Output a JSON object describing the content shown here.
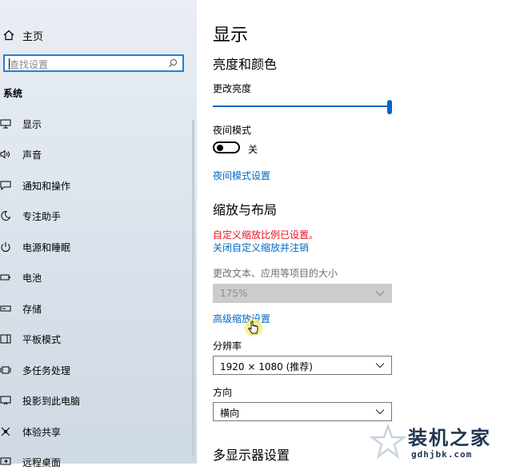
{
  "sidebar": {
    "home_label": "主页",
    "search_placeholder": "查找设置",
    "group_title": "系统",
    "items": [
      {
        "label": "显示",
        "icon": "monitor-icon"
      },
      {
        "label": "声音",
        "icon": "speaker-icon"
      },
      {
        "label": "通知和操作",
        "icon": "notification-icon"
      },
      {
        "label": "专注助手",
        "icon": "moon-icon"
      },
      {
        "label": "电源和睡眠",
        "icon": "power-icon"
      },
      {
        "label": "电池",
        "icon": "battery-icon"
      },
      {
        "label": "存储",
        "icon": "storage-icon"
      },
      {
        "label": "平板模式",
        "icon": "tablet-icon"
      },
      {
        "label": "多任务处理",
        "icon": "multitask-icon"
      },
      {
        "label": "投影到此电脑",
        "icon": "project-icon"
      },
      {
        "label": "体验共享",
        "icon": "share-icon"
      },
      {
        "label": "远程桌面",
        "icon": "remote-desktop-icon"
      }
    ]
  },
  "main": {
    "title": "显示",
    "brightness_section": "亮度和颜色",
    "brightness_label": "更改亮度",
    "brightness_value": 1.0,
    "night_light_label": "夜间模式",
    "night_light_state": "关",
    "night_light_link": "夜间模式设置",
    "scale_section": "缩放与布局",
    "custom_scale_warning": "自定义缩放比例已设置。",
    "custom_scale_link": "关闭自定义缩放并注销",
    "size_label": "更改文本、应用等项目的大小",
    "size_value": "175%",
    "advanced_scale_link": "高级缩放设置",
    "resolution_label": "分辨率",
    "resolution_value": "1920 × 1080 (推荐)",
    "orientation_label": "方向",
    "orientation_value": "横向",
    "multi_display_section": "多显示器设置"
  },
  "watermark": {
    "title": "装机之家",
    "url": "gdhjbk.com"
  },
  "colors": {
    "accent": "#0067c0",
    "warning": "#e81123",
    "sidebar_bg": "#dfe6ee"
  }
}
